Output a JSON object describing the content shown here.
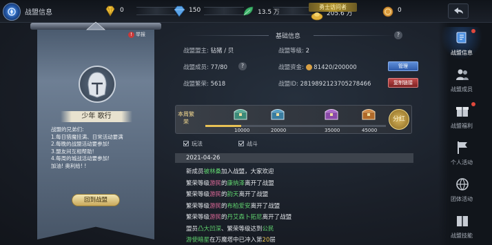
{
  "topbar": {
    "title": "战盟信息",
    "resources": [
      {
        "name": "diamond",
        "value": "0",
        "icon": "yellow-diamond-icon"
      },
      {
        "name": "gem",
        "value": "150",
        "icon": "blue-gem-icon"
      },
      {
        "name": "jade",
        "value": "13.5 万",
        "icon": "green-leaf-icon"
      },
      {
        "name": "gold",
        "value": "205.6 万",
        "icon": "gold-ingot-icon"
      },
      {
        "name": "coin",
        "value": "0",
        "icon": "coin-bag-icon"
      }
    ],
    "notice": "勇士访问者"
  },
  "banner": {
    "report_label": "举报",
    "guild_name": "少年 歌行",
    "motto_lines": [
      "战盟的兄弟们:",
      "1.每日猎魔挂满、日常活动要满",
      "2.每晚的战盟活动要参加!",
      "3.盟友间互相帮助!",
      "4.每周的城战活动要参加!",
      "加油! 奥利给! !"
    ],
    "return_button": "回到战盟"
  },
  "basic_info": {
    "section_title": "基础信息",
    "leader_label": "战盟盟主:",
    "leader_value": "钻猪 / 贝",
    "level_label": "战盟等级:",
    "level_value": "2",
    "members_label": "战盟成员:",
    "members_value": "77/80",
    "funds_label": "战盟资金:",
    "funds_value": "81420/200000",
    "prosperity_label": "战盟繁荣:",
    "prosperity_value": "5618",
    "id_label": "战盟ID:",
    "id_value": "2819892123705278466",
    "manage_button": "管理",
    "copy_button": "复制链接"
  },
  "weekly": {
    "label": "本周繁荣",
    "progress": 0.2,
    "milestones": [
      "10000",
      "20000",
      "35000",
      "45000"
    ],
    "dividend_button": "分红"
  },
  "log_tabs": [
    {
      "label": "玩法"
    },
    {
      "label": "战斗"
    }
  ],
  "log": {
    "date": "2021-04-26",
    "entries": [
      [
        {
          "t": "新成员"
        },
        {
          "t": "被林桑",
          "c": "g"
        },
        {
          "t": "加入战盟，大家欢迎"
        }
      ],
      [
        {
          "t": "繁荣等级"
        },
        {
          "t": "游民",
          "c": "p"
        },
        {
          "t": "的"
        },
        {
          "t": "康纳泽",
          "c": "g"
        },
        {
          "t": "离开了战盟"
        }
      ],
      [
        {
          "t": "繁荣等级"
        },
        {
          "t": "游民",
          "c": "p"
        },
        {
          "t": "的"
        },
        {
          "t": "韵天",
          "c": "g"
        },
        {
          "t": "离开了战盟"
        }
      ],
      [
        {
          "t": "繁荣等级"
        },
        {
          "t": "游民",
          "c": "p"
        },
        {
          "t": "的"
        },
        {
          "t": "布柏爱安",
          "c": "g"
        },
        {
          "t": "离开了战盟"
        }
      ],
      [
        {
          "t": "繁荣等级"
        },
        {
          "t": "游民",
          "c": "p"
        },
        {
          "t": "的"
        },
        {
          "t": "丹艾森卜拓尼",
          "c": "g"
        },
        {
          "t": "离开了战盟"
        }
      ],
      [
        {
          "t": "盟员"
        },
        {
          "t": "凸大凹深",
          "c": "g"
        },
        {
          "t": "、繁荣等级达到"
        },
        {
          "t": "公民",
          "c": "g"
        }
      ],
      [
        {
          "t": "游使暗星",
          "c": "g"
        },
        {
          "t": "在万魔塔中已冲入第"
        },
        {
          "t": "20",
          "c": "y"
        },
        {
          "t": "层"
        }
      ]
    ]
  },
  "sidebar": [
    {
      "label": "战盟信息",
      "icon": "scroll-icon",
      "active": true,
      "dot": true
    },
    {
      "label": "战盟成员",
      "icon": "members-icon",
      "active": false,
      "dot": false
    },
    {
      "label": "战盟福利",
      "icon": "gift-icon",
      "active": false,
      "dot": true
    },
    {
      "label": "个人活动",
      "icon": "flag-icon",
      "active": false,
      "dot": false
    },
    {
      "label": "团体活动",
      "icon": "globe-icon",
      "active": false,
      "dot": false
    },
    {
      "label": "战盟技能",
      "icon": "book-icon",
      "active": false,
      "dot": false
    }
  ],
  "colors": {
    "accent": "#e9c255",
    "member_name": "#5fd16e",
    "rank": "#e06a9a",
    "active_tab": "#3a8cff"
  }
}
